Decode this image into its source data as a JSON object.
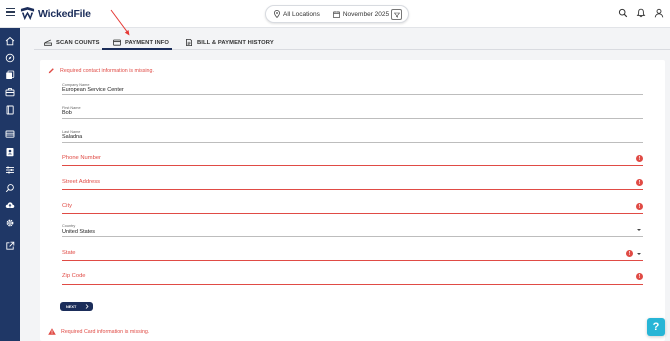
{
  "app": {
    "name": "WickedFile"
  },
  "filters": {
    "location": "All Locations",
    "period": "November 2025"
  },
  "tabs": [
    {
      "label": "SCAN COUNTS",
      "icon": "scanner-icon",
      "active": false
    },
    {
      "label": "PAYMENT INFO",
      "icon": "card-icon",
      "active": true
    },
    {
      "label": "BILL & PAYMENT HISTORY",
      "icon": "receipt-icon",
      "active": false
    }
  ],
  "contact_form": {
    "alert": "Required contact information is missing.",
    "company_name": {
      "label": "Company Name",
      "value": "European Service Center"
    },
    "first_name": {
      "label": "First Name",
      "value": "Bob"
    },
    "last_name": {
      "label": "Last Name",
      "value": "Saladna"
    },
    "phone": {
      "placeholder": "Phone Number"
    },
    "street": {
      "placeholder": "Street Address"
    },
    "city": {
      "placeholder": "City"
    },
    "country": {
      "label": "Country",
      "value": "United States"
    },
    "state": {
      "placeholder": "State"
    },
    "zip": {
      "placeholder": "Zip Code"
    },
    "next_label": "NEXT",
    "error_glyph": "!"
  },
  "card_alert": "Required Card information is missing.",
  "help": {
    "label": "?"
  },
  "colors": {
    "sidebar": "#1f3766",
    "error": "#e04b45",
    "primary": "#1b2d5a",
    "help": "#27b5d6"
  },
  "sidebar_icons": [
    "home-icon",
    "compass-icon",
    "documents-icon",
    "briefcase-icon",
    "book-icon",
    "inbox-icon",
    "contact-card-icon",
    "list-settings-icon",
    "search-icon",
    "cloud-upload-icon",
    "gear-icon",
    "external-link-icon"
  ]
}
